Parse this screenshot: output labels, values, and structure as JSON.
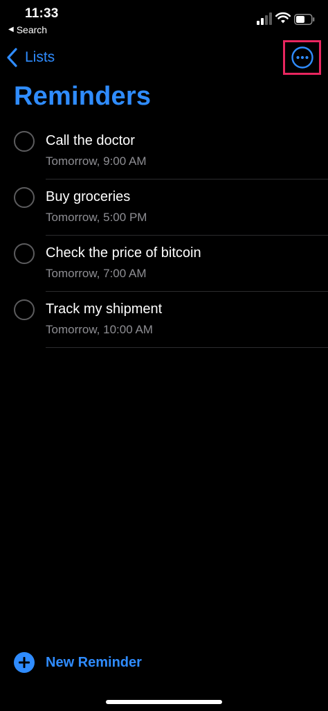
{
  "status_bar": {
    "time": "11:33",
    "back_app_label": "Search",
    "back_app_glyph": "◀"
  },
  "nav": {
    "back_label": "Lists",
    "more_icon": "ellipsis-circle-icon"
  },
  "page": {
    "title": "Reminders"
  },
  "reminders": [
    {
      "title": "Call the doctor",
      "due": "Tomorrow, 9:00 AM"
    },
    {
      "title": "Buy groceries",
      "due": "Tomorrow, 5:00 PM"
    },
    {
      "title": "Check the price of bitcoin",
      "due": "Tomorrow, 7:00 AM"
    },
    {
      "title": "Track my shipment",
      "due": "Tomorrow, 10:00 AM"
    }
  ],
  "footer": {
    "new_reminder_label": "New Reminder"
  },
  "colors": {
    "accent": "#2f8cff",
    "highlight": "#e8265f",
    "secondary_text": "#8e8e93",
    "background": "#000000"
  }
}
